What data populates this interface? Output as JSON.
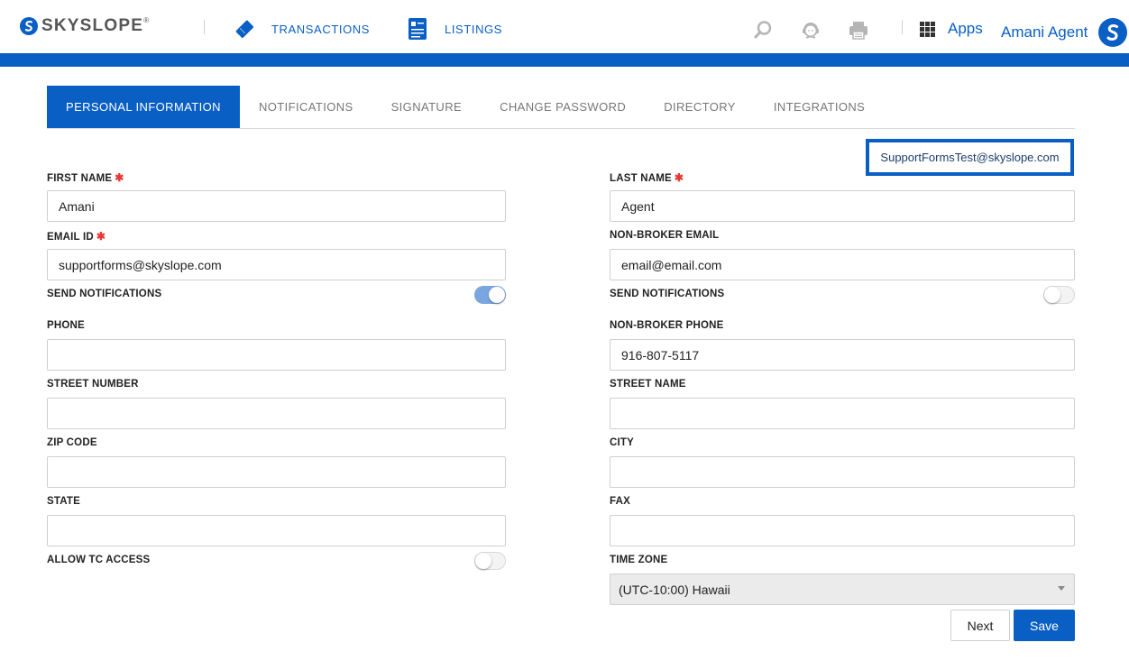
{
  "header": {
    "logo_text": "SKYSLOPE",
    "logo_mark": "®",
    "nav": {
      "transactions": "TRANSACTIONS",
      "listings": "LISTINGS"
    },
    "tools": [
      "search-icon",
      "support-agent-icon",
      "printer-icon"
    ],
    "apps_label": "Apps",
    "user_name": "Amani Agent"
  },
  "tabs": [
    {
      "label": "PERSONAL INFORMATION",
      "active": true
    },
    {
      "label": "NOTIFICATIONS",
      "active": false
    },
    {
      "label": "SIGNATURE",
      "active": false
    },
    {
      "label": "CHANGE PASSWORD",
      "active": false
    },
    {
      "label": "DIRECTORY",
      "active": false
    },
    {
      "label": "INTEGRATIONS",
      "active": false
    }
  ],
  "account_email": "SupportFormsTest@skyslope.com",
  "form": {
    "required_mark": "✱",
    "first_name": {
      "label": "FIRST NAME",
      "value": "Amani"
    },
    "last_name": {
      "label": "LAST NAME",
      "value": "Agent"
    },
    "email_id": {
      "label": "EMAIL ID",
      "value": "supportforms@skyslope.com"
    },
    "non_broker_email": {
      "label": "NON-BROKER EMAIL",
      "value": "email@email.com"
    },
    "send_notifications_left": {
      "label": "SEND NOTIFICATIONS",
      "on": true
    },
    "send_notifications_right": {
      "label": "SEND NOTIFICATIONS",
      "on": false
    },
    "phone": {
      "label": "PHONE",
      "value": ""
    },
    "non_broker_phone": {
      "label": "NON-BROKER PHONE",
      "value": "916-807-5117"
    },
    "street_number": {
      "label": "STREET NUMBER",
      "value": ""
    },
    "street_name": {
      "label": "STREET NAME",
      "value": ""
    },
    "zip_code": {
      "label": "ZIP CODE",
      "value": ""
    },
    "city": {
      "label": "CITY",
      "value": ""
    },
    "state": {
      "label": "STATE",
      "value": ""
    },
    "fax": {
      "label": "FAX",
      "value": ""
    },
    "allow_tc_access": {
      "label": "ALLOW TC ACCESS",
      "on": false
    },
    "time_zone": {
      "label": "TIME ZONE",
      "value": "(UTC-10:00) Hawaii"
    }
  },
  "buttons": {
    "next": "Next",
    "save": "Save"
  },
  "colors": {
    "brand": "#0a5fc4",
    "required": "#e53935",
    "toggle_on": "#7aa6e0"
  }
}
